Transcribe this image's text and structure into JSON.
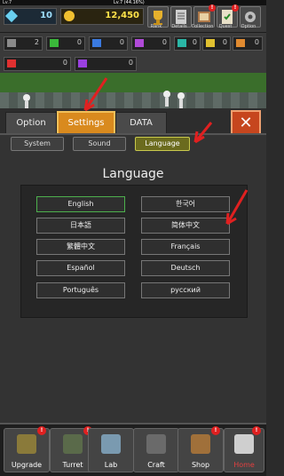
{
  "status": {
    "level": "Lv.7",
    "progress": "Lv.7 (44.16%)"
  },
  "currency": {
    "gems": "10",
    "gold": "12,450"
  },
  "top_icons": [
    {
      "label": "Rank",
      "icon": "trophy-icon"
    },
    {
      "label": "Details",
      "icon": "details-icon"
    },
    {
      "label": "Collection",
      "icon": "collection-icon"
    },
    {
      "label": "Quest",
      "icon": "quest-icon"
    },
    {
      "label": "Option",
      "icon": "option-icon"
    }
  ],
  "resources_row1": [
    "2",
    "0",
    "0",
    "0",
    "0",
    "0",
    "0"
  ],
  "resources_row2": [
    "0",
    "0"
  ],
  "tabs": [
    "Option",
    "Settings",
    "DATA"
  ],
  "subtabs": [
    "System",
    "Sound",
    "Language"
  ],
  "language": {
    "title": "Language",
    "options": [
      "English",
      "한국어",
      "日本語",
      "简体中文",
      "繁體中文",
      "Français",
      "Español",
      "Deutsch",
      "Português",
      "русский"
    ]
  },
  "nav": [
    "Upgrade",
    "Turret",
    "Lab",
    "Craft",
    "Shop",
    "Home"
  ],
  "colors": {
    "accent": "#d98a1e",
    "selected_subtab": "#6b6b1e",
    "alert": "#e02020"
  }
}
